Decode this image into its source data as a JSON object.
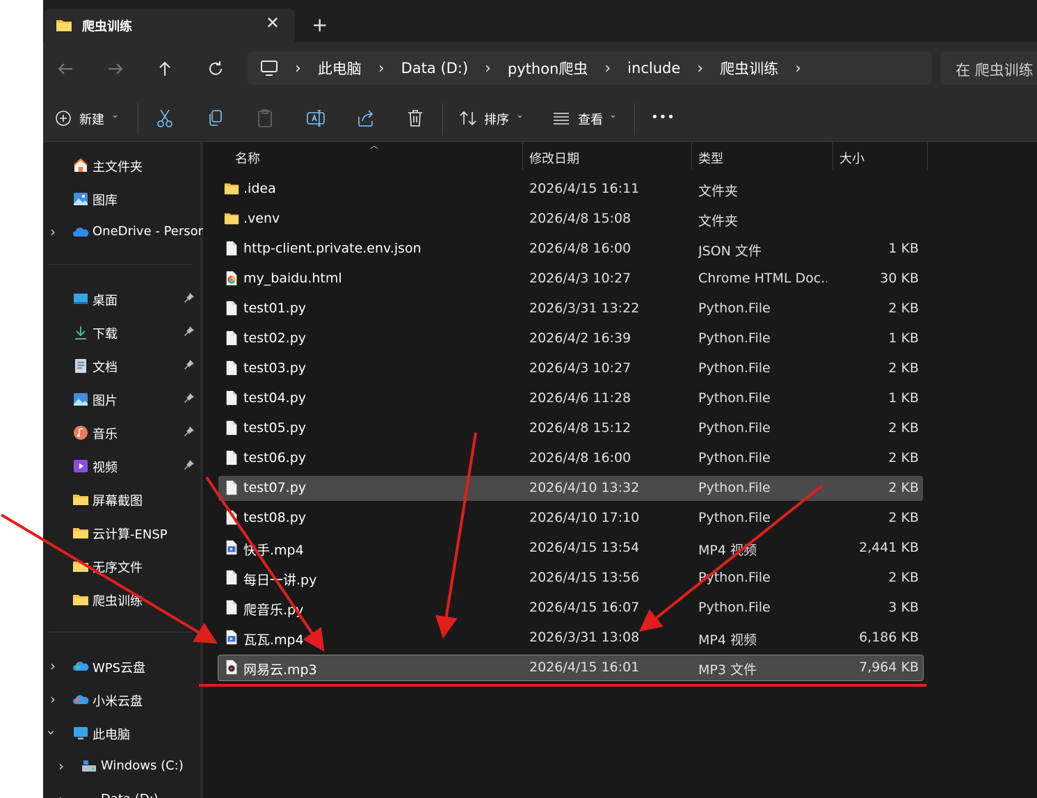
{
  "tab": {
    "title": "爬虫训练",
    "close": "✕",
    "new_tab": "+"
  },
  "breadcrumb": [
    "此电脑",
    "Data (D:)",
    "python爬虫",
    "include",
    "爬虫训练"
  ],
  "breadcrumb_separator": "›",
  "search": {
    "placeholder": "在 爬虫训练"
  },
  "toolbar": {
    "new_label": "新建",
    "sort_label": "排序",
    "view_label": "查看",
    "more_label": "•••",
    "caret": "⌄"
  },
  "sidebar": {
    "items": [
      {
        "label": "主文件夹",
        "icon": "home-icon"
      },
      {
        "label": "图库",
        "icon": "gallery-icon"
      },
      {
        "label": "OneDrive - Persor",
        "icon": "onedrive-icon"
      },
      {
        "label": "桌面",
        "icon": "desktop-icon"
      },
      {
        "label": "下载",
        "icon": "download-icon"
      },
      {
        "label": "文档",
        "icon": "documents-icon"
      },
      {
        "label": "图片",
        "icon": "pictures-icon"
      },
      {
        "label": "音乐",
        "icon": "music-icon"
      },
      {
        "label": "视频",
        "icon": "videos-icon"
      },
      {
        "label": "屏幕截图",
        "icon": "folder-icon"
      },
      {
        "label": "云计算-ENSP",
        "icon": "folder-icon"
      },
      {
        "label": "无序文件",
        "icon": "folder-icon"
      },
      {
        "label": "爬虫训练",
        "icon": "folder-icon"
      },
      {
        "label": "WPS云盘",
        "icon": "cloud-icon"
      },
      {
        "label": "小米云盘",
        "icon": "cloud-icon"
      },
      {
        "label": "此电脑",
        "icon": "pc-icon"
      },
      {
        "label": "Windows (C:)",
        "icon": "drive-icon"
      },
      {
        "label": "Data (D:)",
        "icon": "drive-icon"
      }
    ]
  },
  "columns": {
    "name": "名称",
    "date": "修改日期",
    "type": "类型",
    "size": "大小"
  },
  "files": [
    {
      "name": ".idea",
      "date": "2026/4/15 16:11",
      "type": "文件夹",
      "size": "",
      "icon": "folder-icon"
    },
    {
      "name": ".venv",
      "date": "2026/4/8 15:08",
      "type": "文件夹",
      "size": "",
      "icon": "folder-icon"
    },
    {
      "name": "http-client.private.env.json",
      "date": "2026/4/8 16:00",
      "type": "JSON 文件",
      "size": "1 KB",
      "icon": "file-icon"
    },
    {
      "name": "my_baidu.html",
      "date": "2026/4/3 10:27",
      "type": "Chrome HTML Doc...",
      "size": "30 KB",
      "icon": "chrome-icon"
    },
    {
      "name": "test01.py",
      "date": "2026/3/31 13:22",
      "type": "Python.File",
      "size": "2 KB",
      "icon": "file-icon"
    },
    {
      "name": "test02.py",
      "date": "2026/4/2 16:39",
      "type": "Python.File",
      "size": "1 KB",
      "icon": "file-icon"
    },
    {
      "name": "test03.py",
      "date": "2026/4/3 10:27",
      "type": "Python.File",
      "size": "2 KB",
      "icon": "file-icon"
    },
    {
      "name": "test04.py",
      "date": "2026/4/6 11:28",
      "type": "Python.File",
      "size": "1 KB",
      "icon": "file-icon"
    },
    {
      "name": "test05.py",
      "date": "2026/4/8 15:12",
      "type": "Python.File",
      "size": "2 KB",
      "icon": "file-icon"
    },
    {
      "name": "test06.py",
      "date": "2026/4/8 16:00",
      "type": "Python.File",
      "size": "2 KB",
      "icon": "file-icon"
    },
    {
      "name": "test07.py",
      "date": "2026/4/10 13:32",
      "type": "Python.File",
      "size": "2 KB",
      "icon": "file-icon"
    },
    {
      "name": "test08.py",
      "date": "2026/4/10 17:10",
      "type": "Python.File",
      "size": "2 KB",
      "icon": "file-icon"
    },
    {
      "name": "快手.mp4",
      "date": "2026/4/15 13:54",
      "type": "MP4 视频",
      "size": "2,441 KB",
      "icon": "video-file-icon"
    },
    {
      "name": "每日一讲.py",
      "date": "2026/4/15 13:56",
      "type": "Python.File",
      "size": "2 KB",
      "icon": "file-icon"
    },
    {
      "name": "爬音乐.py",
      "date": "2026/4/15 16:07",
      "type": "Python.File",
      "size": "3 KB",
      "icon": "file-icon"
    },
    {
      "name": "瓦瓦.mp4",
      "date": "2026/3/31 13:08",
      "type": "MP4 视频",
      "size": "6,186 KB",
      "icon": "video-file-icon"
    },
    {
      "name": "网易云.mp3",
      "date": "2026/4/15 16:01",
      "type": "MP3 文件",
      "size": "7,964 KB",
      "icon": "audio-file-icon"
    }
  ],
  "colors": {
    "window_bg": "#191919",
    "sidebar_bg": "#202020",
    "selection": "#4a4a4a",
    "annotation_red": "#e01e1e",
    "folder": "#f5c243"
  }
}
